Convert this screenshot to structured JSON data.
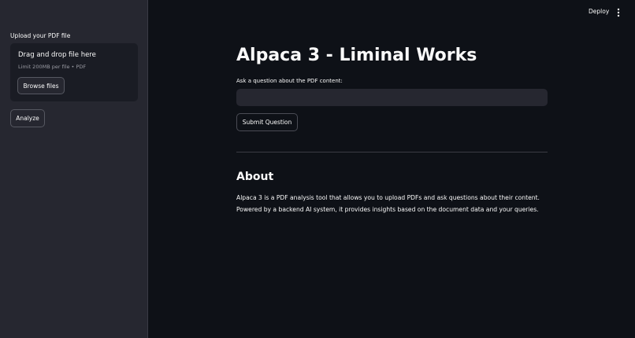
{
  "sidebar": {
    "upload_label": "Upload your PDF file",
    "dropzone": {
      "title": "Drag and drop file here",
      "limit": "Limit 200MB per file • PDF",
      "browse_label": "Browse files"
    },
    "analyze_label": "Analyze"
  },
  "topbar": {
    "deploy_label": "Deploy",
    "menu_icon": "more-vertical-icon"
  },
  "main": {
    "title": "Alpaca 3 - Liminal Works",
    "question_label": "Ask a question about the PDF content:",
    "question_value": "",
    "submit_label": "Submit Question",
    "about": {
      "heading": "About",
      "line1": "Alpaca 3 is a PDF analysis tool that allows you to upload PDFs and ask questions about their content.",
      "line2": "Powered by a backend AI system, it provides insights based on the document data and your queries."
    }
  },
  "colors": {
    "background": "#0e1117",
    "sidebar": "#262730",
    "input": "#262730",
    "text": "#fafafa"
  }
}
